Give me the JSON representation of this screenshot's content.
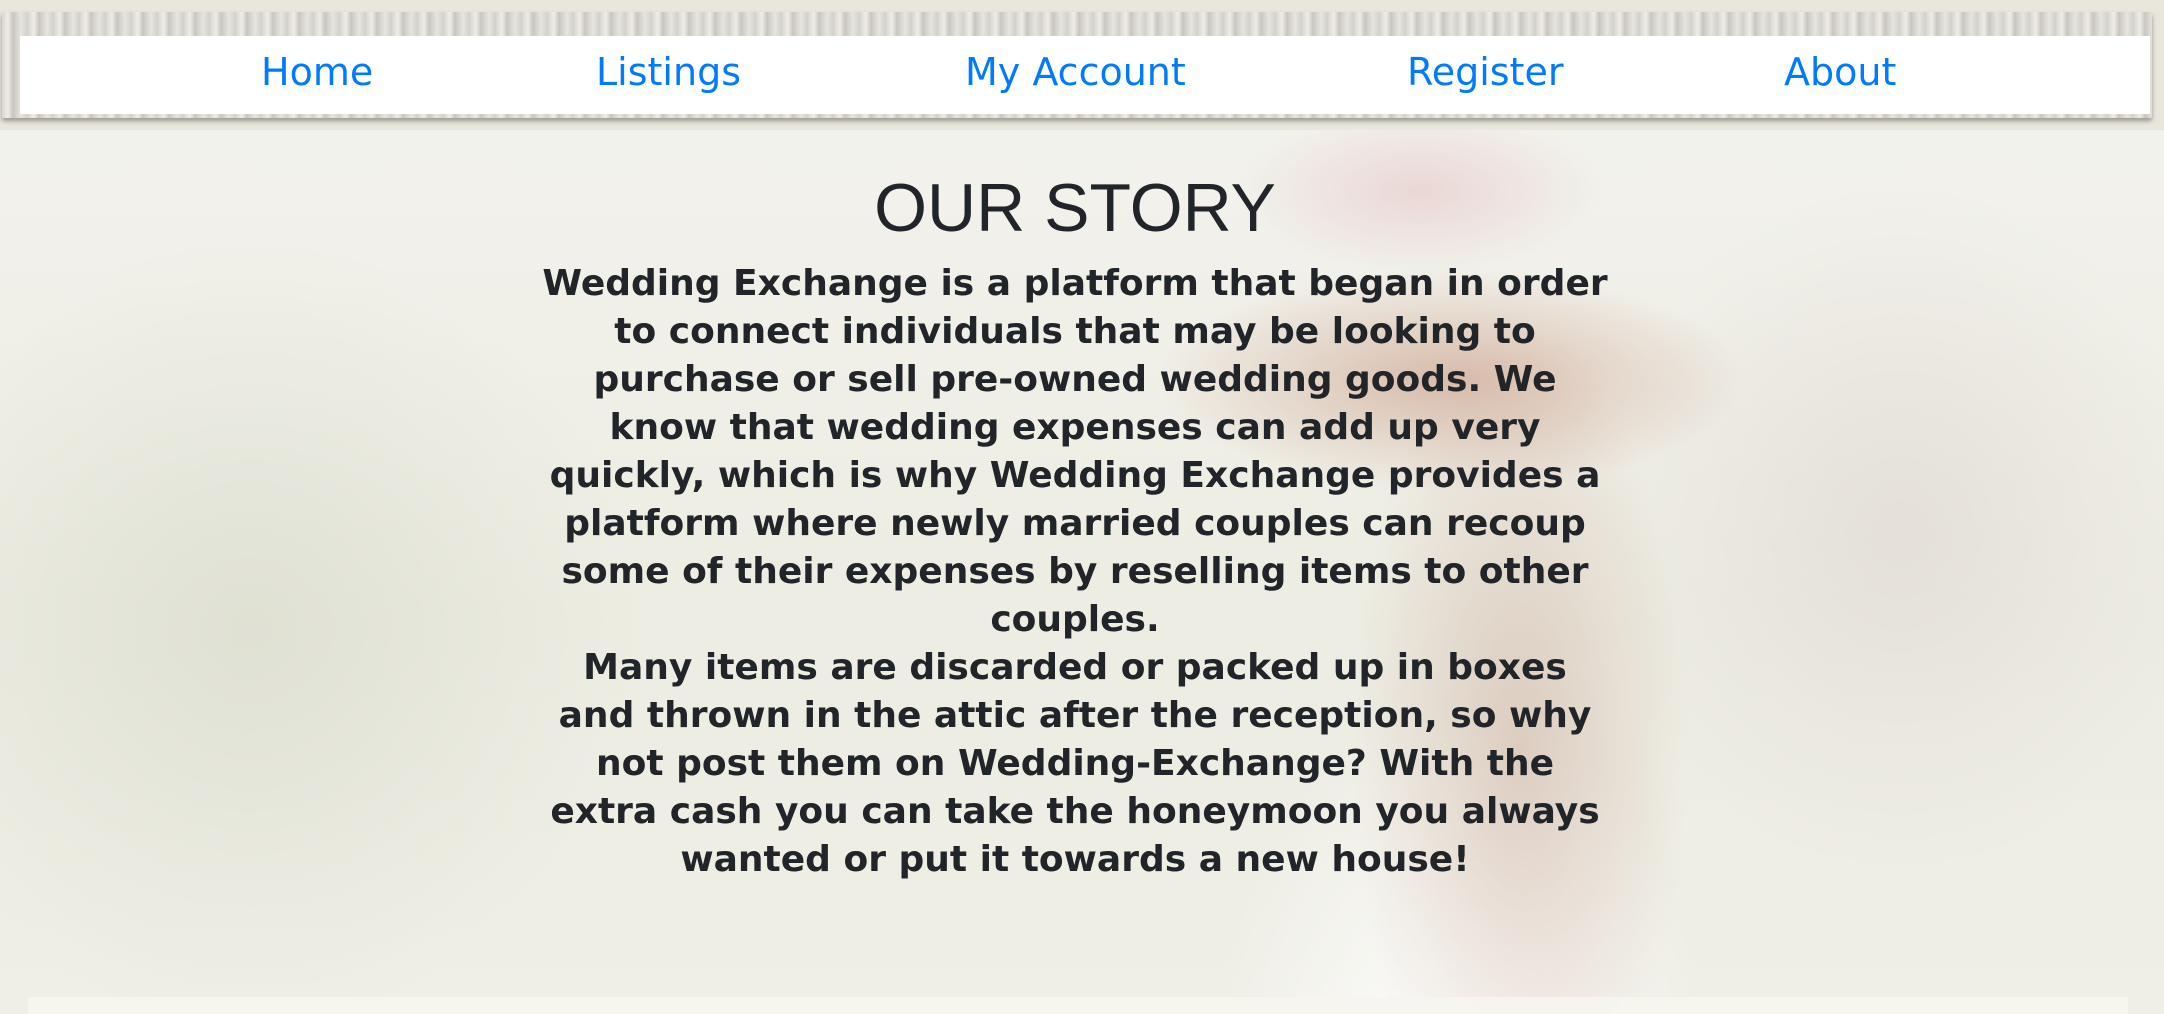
{
  "nav": {
    "items": [
      {
        "label": "Home"
      },
      {
        "label": "Listings"
      },
      {
        "label": "My Account"
      },
      {
        "label": "Register"
      },
      {
        "label": "About"
      }
    ]
  },
  "main": {
    "title": "OUR STORY",
    "paragraph_1": "Wedding Exchange is a platform that began in order to connect individuals that may be looking to purchase or sell pre-owned wedding goods. We know that wedding expenses can add up very quickly, which is why Wedding Exchange provides a platform where newly married couples can recoup some of their expenses by reselling items to other couples.",
    "paragraph_2": "Many items are discarded or packed up in boxes and thrown in the attic after the reception, so why not post them on Wedding-Exchange? With the extra cash you can take the honeymoon you always wanted or put it towards a new house!"
  },
  "colors": {
    "link": "#007bff",
    "text": "#212529"
  }
}
